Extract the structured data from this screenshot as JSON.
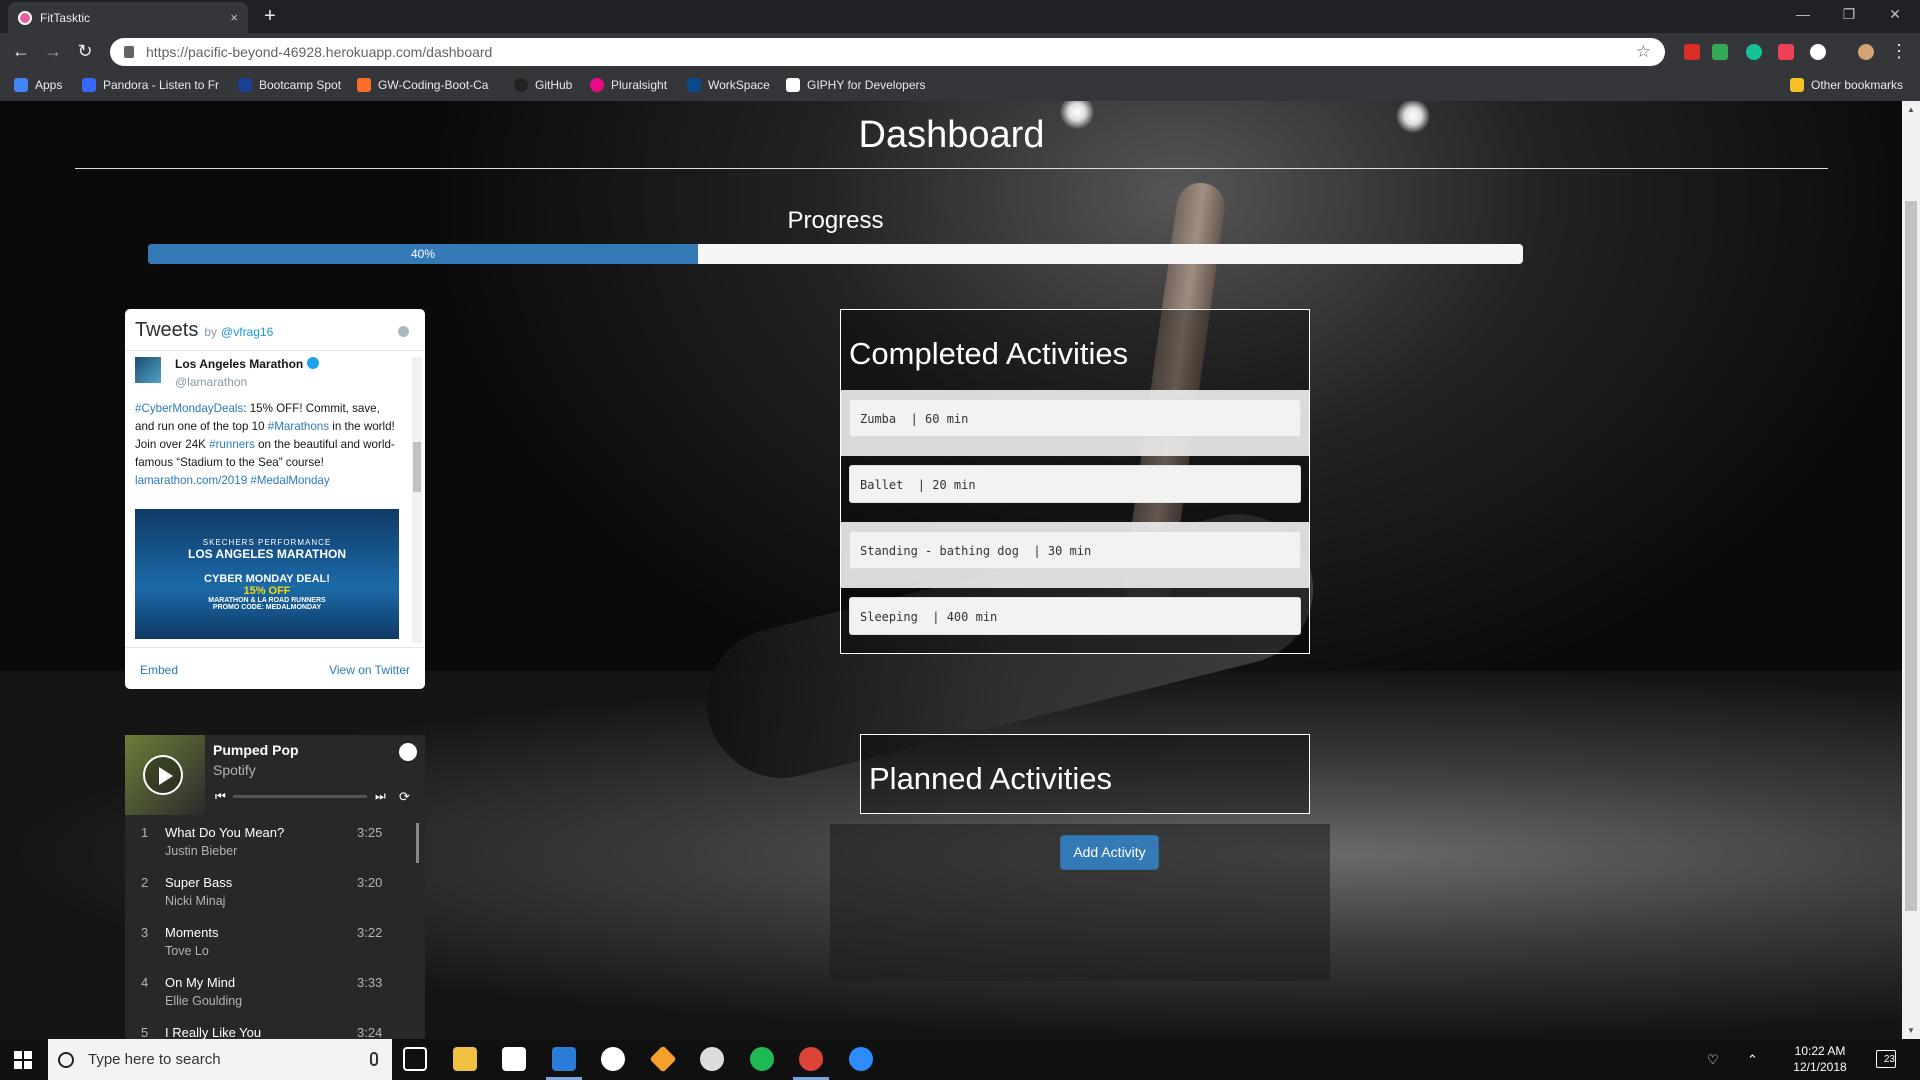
{
  "browser": {
    "tab_title": "FitTasktic",
    "tab_close": "×",
    "new_tab": "+",
    "url": "https://pacific-beyond-46928.herokuapp.com/dashboard",
    "bookmarks": [
      {
        "label": "Apps",
        "color": "#4285f4"
      },
      {
        "label": "Pandora - Listen to Fr",
        "color": "#3668ff"
      },
      {
        "label": "Bootcamp Spot",
        "color": "#1c3f94"
      },
      {
        "label": "GW-Coding-Boot-Ca",
        "color": "#fc6d26"
      },
      {
        "label": "GitHub",
        "color": "#222222"
      },
      {
        "label": "Pluralsight",
        "color": "#e80a89"
      },
      {
        "label": "WorkSpace",
        "color": "#0a4a8a"
      },
      {
        "label": "GIPHY for Developers",
        "color": "#ffffff"
      }
    ],
    "other_bookmarks": "Other bookmarks"
  },
  "dashboard": {
    "title": "Dashboard",
    "progress_label": "Progress",
    "progress_value": 0.4,
    "progress_text": "40%"
  },
  "tweets": {
    "title": "Tweets",
    "by": "by",
    "handle": "@vfrag16",
    "tweet": {
      "name": "Los Angeles Marathon",
      "handle": "@lamarathon",
      "hashtag1": "#CyberMondayDeals",
      "text1": ": 15% OFF! Commit, save, and run one of the top 10 ",
      "hashtag2": "#Marathons",
      "text2": " in the world! Join over 24K ",
      "hashtag3": "#runners",
      "text3": " on the beautiful and world-famous “Stadium to the Sea” course! ",
      "link": "lamarathon.com/2019",
      "hashtag4": "#MedalMonday",
      "image_line1": "SKECHERS PERFORMANCE",
      "image_line2": "LOS ANGELES MARATHON",
      "image_line3": "CYBER MONDAY DEAL!",
      "image_line4": "15% OFF",
      "image_line5": "MARATHON & LA ROAD RUNNERS",
      "image_line6": "PROMO CODE: MEDALMONDAY"
    },
    "embed": "Embed",
    "view_on_twitter": "View on Twitter"
  },
  "spotify": {
    "playlist": "Pumped Pop",
    "owner": "Spotify",
    "tracks": [
      {
        "num": "1",
        "song": "What Do You Mean?",
        "artist": "Justin Bieber",
        "duration": "3:25"
      },
      {
        "num": "2",
        "song": "Super Bass",
        "artist": "Nicki Minaj",
        "duration": "3:20"
      },
      {
        "num": "3",
        "song": "Moments",
        "artist": "Tove Lo",
        "duration": "3:22"
      },
      {
        "num": "4",
        "song": "On My Mind",
        "artist": "Ellie Goulding",
        "duration": "3:33"
      },
      {
        "num": "5",
        "song": "I Really Like You",
        "artist": "",
        "duration": "3:24"
      }
    ]
  },
  "completed": {
    "title": "Completed Activities",
    "items": [
      {
        "text": "Zumba  | 60 min"
      },
      {
        "text": "Ballet  | 20 min"
      },
      {
        "text": "Standing - bathing dog  | 30 min"
      },
      {
        "text": "Sleeping  | 400 min"
      }
    ]
  },
  "planned": {
    "title": "Planned Activities",
    "add_button": "Add Activity"
  },
  "taskbar": {
    "search_placeholder": "Type here to search",
    "time": "10:22 AM",
    "date": "12/1/2018",
    "notification_count": "23"
  },
  "colors": {
    "accent": "#337ab7",
    "tweet_link": "#2b7bb9",
    "spotify_bg": "#282828"
  }
}
